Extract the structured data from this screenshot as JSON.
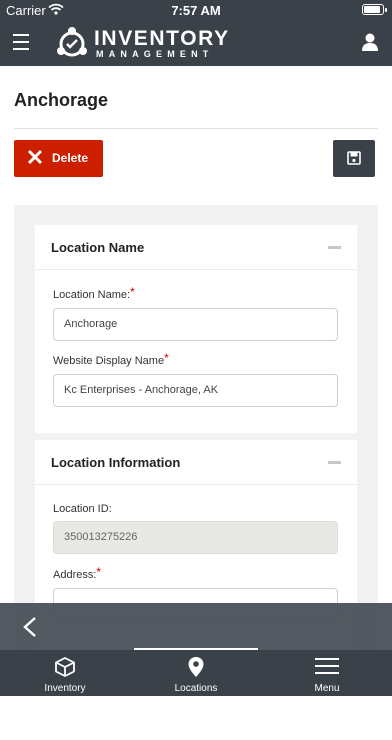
{
  "status": {
    "carrier": "Carrier",
    "time": "7:57 AM"
  },
  "header": {
    "logo_line1": "INVENTORY",
    "logo_line2": "MANAGEMENT"
  },
  "page": {
    "title": "Anchorage"
  },
  "actions": {
    "delete_label": "Delete"
  },
  "sections": {
    "location_name": {
      "title": "Location Name",
      "location_name_label": "Location Name:",
      "location_name_value": "Anchorage",
      "website_display_label": "Website Display Name",
      "website_display_value": "Kc Enterprises - Anchorage, AK",
      "required_mark": "*"
    },
    "location_info": {
      "title": "Location Information",
      "location_id_label": "Location ID:",
      "location_id_value": "350013275226",
      "address_label": "Address:",
      "required_mark": "*"
    }
  },
  "tabs": [
    {
      "label": "Inventory",
      "icon": "box-icon"
    },
    {
      "label": "Locations",
      "icon": "map-pin-icon",
      "active": true
    },
    {
      "label": "Menu",
      "icon": "menu-icon"
    }
  ],
  "colors": {
    "brand_dark": "#3a4149",
    "delete_red": "#cc1f00",
    "required_red": "#d40000"
  }
}
